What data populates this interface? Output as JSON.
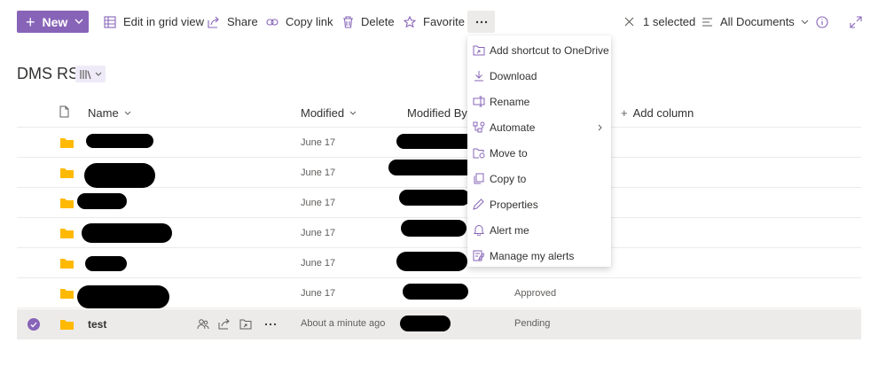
{
  "toolbar": {
    "new_label": "New",
    "edit_grid_label": "Edit in grid view",
    "share_label": "Share",
    "copy_link_label": "Copy link",
    "delete_label": "Delete",
    "favorite_label": "Favorite",
    "selected_label": "1 selected",
    "view_label": "All Documents"
  },
  "library": {
    "title": "DMS RS"
  },
  "columns": {
    "name": "Name",
    "modified": "Modified",
    "modified_by": "Modified By",
    "add_column": "Add column"
  },
  "rows": [
    {
      "modified": "June 17",
      "status": ""
    },
    {
      "modified": "June 17",
      "status": ""
    },
    {
      "modified": "June 17",
      "status": ""
    },
    {
      "modified": "June 17",
      "status": ""
    },
    {
      "modified": "June 17",
      "status": ""
    },
    {
      "modified": "June 17",
      "status": "Approved"
    },
    {
      "name": "test",
      "modified": "About a minute ago",
      "status": "Pending"
    }
  ],
  "menu": {
    "items": [
      {
        "label": "Add shortcut to OneDrive",
        "icon": "shortcut-icon"
      },
      {
        "label": "Download",
        "icon": "download-icon"
      },
      {
        "label": "Rename",
        "icon": "rename-icon"
      },
      {
        "label": "Automate",
        "icon": "automate-icon"
      },
      {
        "label": "Move to",
        "icon": "move-icon"
      },
      {
        "label": "Copy to",
        "icon": "copy-icon"
      },
      {
        "label": "Properties",
        "icon": "pencil-icon"
      },
      {
        "label": "Alert me",
        "icon": "bell-icon"
      },
      {
        "label": "Manage my alerts",
        "icon": "manage-alerts-icon"
      }
    ]
  },
  "colors": {
    "accent": "#8764b8",
    "selected_row": "#edebe9",
    "folder": "#ffb900"
  }
}
